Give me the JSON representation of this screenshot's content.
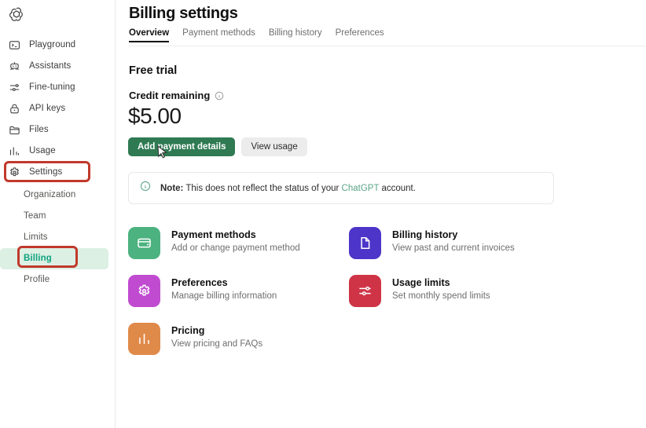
{
  "sidebar": {
    "logo_name": "openai-logo",
    "items": [
      {
        "label": "Playground",
        "icon": "terminal-icon"
      },
      {
        "label": "Assistants",
        "icon": "robot-icon"
      },
      {
        "label": "Fine-tuning",
        "icon": "sliders-icon"
      },
      {
        "label": "API keys",
        "icon": "lock-icon"
      },
      {
        "label": "Files",
        "icon": "folder-icon"
      },
      {
        "label": "Usage",
        "icon": "bar-chart-icon"
      },
      {
        "label": "Settings",
        "icon": "gear-icon"
      }
    ],
    "sub_items": [
      {
        "label": "Organization",
        "active": false
      },
      {
        "label": "Team",
        "active": false
      },
      {
        "label": "Limits",
        "active": false
      },
      {
        "label": "Billing",
        "active": true
      },
      {
        "label": "Profile",
        "active": false
      }
    ]
  },
  "header": {
    "title": "Billing settings",
    "tabs": [
      {
        "label": "Overview",
        "active": true
      },
      {
        "label": "Payment methods",
        "active": false
      },
      {
        "label": "Billing history",
        "active": false
      },
      {
        "label": "Preferences",
        "active": false
      }
    ]
  },
  "overview": {
    "plan_title": "Free trial",
    "credit_label": "Credit remaining",
    "credit_amount": "$5.00",
    "primary_button": "Add payment details",
    "secondary_button": "View usage",
    "note": {
      "bold_prefix": "Note:",
      "text_before_link": " This does not reflect the status of your ",
      "link_text": "ChatGPT",
      "text_after_link": " account."
    }
  },
  "cards": [
    {
      "title": "Payment methods",
      "subtitle": "Add or change payment method",
      "icon": "credit-card-icon",
      "color": "#4cb27f"
    },
    {
      "title": "Billing history",
      "subtitle": "View past and current invoices",
      "icon": "document-icon",
      "color": "#4c35c8"
    },
    {
      "title": "Preferences",
      "subtitle": "Manage billing information",
      "icon": "gear-icon",
      "color": "#c04bd0"
    },
    {
      "title": "Usage limits",
      "subtitle": "Set monthly spend limits",
      "icon": "sliders-icon",
      "color": "#cf3446"
    },
    {
      "title": "Pricing",
      "subtitle": "View pricing and FAQs",
      "icon": "bar-chart-icon",
      "color": "#e08a4a"
    }
  ],
  "annotations": {
    "highlight_color": "#c0392b",
    "boxes": [
      "settings-nav-item",
      "billing-sub-item"
    ]
  },
  "colors": {
    "accent_green": "#10a37f",
    "active_pill": "#dcf0e4",
    "primary_button": "#2f7a52",
    "link": "#5aa588"
  }
}
